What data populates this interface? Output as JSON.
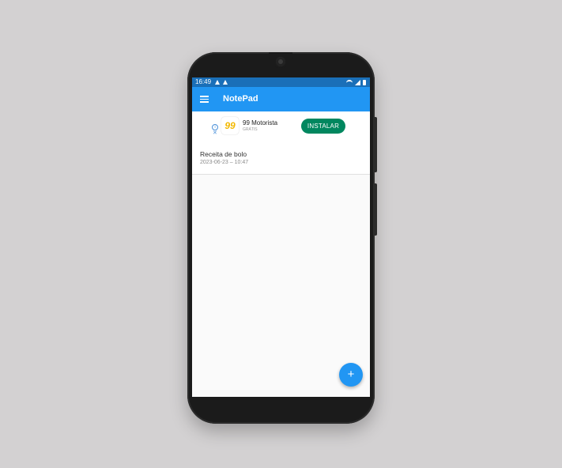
{
  "status_bar": {
    "time": "16:49"
  },
  "app_bar": {
    "title": "NotePad"
  },
  "ad": {
    "logo_text": "99",
    "app_name": "99 Motorista",
    "subtitle": "GRÁTIS",
    "install_label": "INSTALAR",
    "info_glyph": "i",
    "close_glyph": "✕",
    "install_color": "#01875f",
    "logo_color": "#f2b800"
  },
  "notes": [
    {
      "title": "Receita de bolo",
      "date": "2023-06-23 – 10:47"
    }
  ],
  "fab": {
    "glyph": "+"
  },
  "colors": {
    "primary": "#2196f3",
    "status_bar": "#1a6fb8",
    "background": "#fafafa"
  },
  "icons": {
    "menu": "menu-icon",
    "warning": "warning-icon",
    "wifi": "wifi-icon",
    "signal": "signal-icon",
    "battery": "battery-icon",
    "add": "add-icon"
  }
}
